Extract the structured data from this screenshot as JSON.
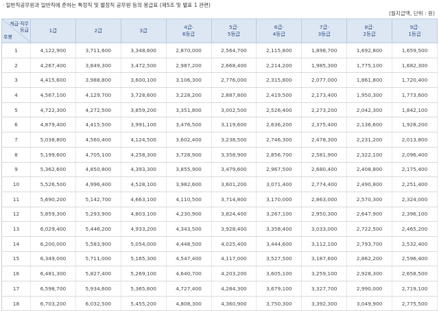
{
  "title": "일반직공무원과 일반직에 준하는 특정직 및 별정직 공무원 등의 봉급표 (제5조 및 별표 1 관련)",
  "unit": "(월지급액, 단위 : 원)",
  "header": {
    "corner_top_line1": "계급·직무",
    "corner_top_line2": "등급",
    "corner_bottom": "호봉",
    "grades": [
      [
        "1급"
      ],
      [
        "2급"
      ],
      [
        "3급"
      ],
      [
        "4급·",
        "6등급"
      ],
      [
        "5급·",
        "5등급"
      ],
      [
        "6급·",
        "4등급"
      ],
      [
        "7급·",
        "3등급"
      ],
      [
        "8급·",
        "2등급"
      ],
      [
        "9급·",
        "1등급"
      ]
    ]
  },
  "rows": [
    {
      "step": "1",
      "values": [
        "4,122,900",
        "3,711,600",
        "3,348,600",
        "2,870,000",
        "2,564,700",
        "2,115,800",
        "1,898,700",
        "1,692,800",
        "1,659,500"
      ]
    },
    {
      "step": "2",
      "values": [
        "4,267,400",
        "3,849,300",
        "3,472,500",
        "2,987,200",
        "2,668,400",
        "2,214,200",
        "1,985,300",
        "1,775,100",
        "1,682,300"
      ]
    },
    {
      "step": "3",
      "values": [
        "4,415,600",
        "3,988,800",
        "3,600,100",
        "3,106,300",
        "2,776,000",
        "2,315,800",
        "2,077,000",
        "1,861,800",
        "1,720,400"
      ]
    },
    {
      "step": "4",
      "values": [
        "4,567,100",
        "4,129,700",
        "3,728,600",
        "3,228,200",
        "2,887,800",
        "2,419,500",
        "2,173,400",
        "1,950,300",
        "1,773,600"
      ]
    },
    {
      "step": "5",
      "values": [
        "4,722,300",
        "4,272,500",
        "3,859,200",
        "3,351,800",
        "3,002,500",
        "2,526,400",
        "2,273,200",
        "2,042,300",
        "1,842,100"
      ]
    },
    {
      "step": "6",
      "values": [
        "4,879,400",
        "4,415,500",
        "3,991,100",
        "3,476,500",
        "3,119,600",
        "2,636,200",
        "2,375,400",
        "2,136,600",
        "1,928,200"
      ]
    },
    {
      "step": "7",
      "values": [
        "5,038,800",
        "4,560,400",
        "4,124,500",
        "3,602,400",
        "3,238,500",
        "2,746,300",
        "2,478,300",
        "2,231,200",
        "2,013,800"
      ]
    },
    {
      "step": "8",
      "values": [
        "5,199,600",
        "4,705,100",
        "4,258,300",
        "3,728,900",
        "3,358,900",
        "2,856,700",
        "2,581,900",
        "2,322,100",
        "2,096,400"
      ]
    },
    {
      "step": "9",
      "values": [
        "5,362,600",
        "4,850,800",
        "4,393,300",
        "3,855,900",
        "3,479,600",
        "2,967,500",
        "2,680,400",
        "2,408,800",
        "2,175,400"
      ]
    },
    {
      "step": "10",
      "values": [
        "5,526,500",
        "4,996,400",
        "4,528,100",
        "3,982,600",
        "3,601,200",
        "3,071,400",
        "2,774,400",
        "2,490,800",
        "2,251,400"
      ]
    },
    {
      "step": "11",
      "values": [
        "5,690,200",
        "5,142,700",
        "4,663,100",
        "4,110,500",
        "3,714,800",
        "3,170,000",
        "2,863,000",
        "2,570,300",
        "2,324,000"
      ]
    },
    {
      "step": "12",
      "values": [
        "5,859,300",
        "5,293,900",
        "4,803,100",
        "4,230,900",
        "3,824,400",
        "3,267,100",
        "2,950,300",
        "2,647,900",
        "2,396,100"
      ]
    },
    {
      "step": "13",
      "values": [
        "6,029,400",
        "5,446,200",
        "4,933,200",
        "4,343,500",
        "3,928,400",
        "3,358,400",
        "3,033,000",
        "2,722,500",
        "2,465,200"
      ]
    },
    {
      "step": "14",
      "values": [
        "6,200,000",
        "5,583,900",
        "5,054,000",
        "4,448,500",
        "4,025,400",
        "3,444,600",
        "3,112,100",
        "2,793,700",
        "2,532,400"
      ]
    },
    {
      "step": "15",
      "values": [
        "6,349,000",
        "5,711,000",
        "5,165,300",
        "4,547,400",
        "4,117,000",
        "3,527,500",
        "3,187,600",
        "2,862,200",
        "2,596,400"
      ]
    },
    {
      "step": "16",
      "values": [
        "6,481,300",
        "5,827,400",
        "5,269,100",
        "4,640,700",
        "4,203,200",
        "3,605,100",
        "3,259,100",
        "2,928,300",
        "2,658,500"
      ]
    },
    {
      "step": "17",
      "values": [
        "6,598,700",
        "5,934,600",
        "5,365,600",
        "4,727,400",
        "4,284,300",
        "3,679,100",
        "3,327,700",
        "2,990,000",
        "2,719,100"
      ]
    },
    {
      "step": "18",
      "values": [
        "6,703,200",
        "6,032,500",
        "5,455,200",
        "4,808,300",
        "4,360,900",
        "3,750,300",
        "3,392,300",
        "3,049,900",
        "2,775,500"
      ]
    }
  ]
}
